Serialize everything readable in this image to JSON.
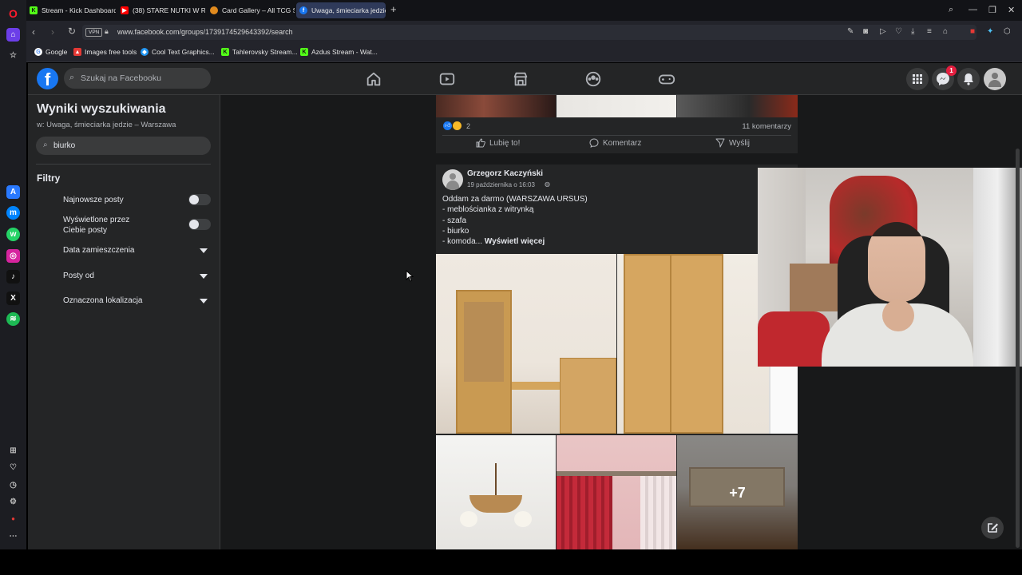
{
  "browser": {
    "tabs": [
      {
        "label": "Stream - Kick Dashboard",
        "active": false,
        "fav_color": "#53fc18",
        "fav_glyph": "K"
      },
      {
        "label": "(38) STARE NUTKI W RE",
        "active": false,
        "fav_color": "#ff0000",
        "fav_glyph": "▶"
      },
      {
        "label": "Card Gallery – All TCG Set",
        "active": false,
        "fav_color": "#e08a1e",
        "fav_glyph": "●"
      },
      {
        "label": "Uwaga, śmieciarka jedzie",
        "active": true,
        "fav_color": "#1877f2",
        "fav_glyph": "f"
      }
    ],
    "vpn_label": "VPN",
    "url": "www.facebook.com/groups/1739174529643392/search",
    "bookmarks": [
      {
        "label": "Google",
        "fav_color": "#4285f4",
        "fav_glyph": "G"
      },
      {
        "label": "Images free tools",
        "fav_color": "#e53935",
        "fav_glyph": "▲"
      },
      {
        "label": "Cool Text Graphics...",
        "fav_color": "#2196f3",
        "fav_glyph": "◆"
      },
      {
        "label": "Tahlerovsky Stream...",
        "fav_color": "#53fc18",
        "fav_glyph": "K"
      },
      {
        "label": "Azdus Stream - Wat...",
        "fav_color": "#53fc18",
        "fav_glyph": "K"
      }
    ]
  },
  "facebook": {
    "search_placeholder": "Szukaj na Facebooku",
    "notification_count": "1",
    "left_panel": {
      "title": "Wyniki wyszukiwania",
      "subtitle": "w: Uwaga, śmieciarka jedzie – Warszawa",
      "search_value": "biurko",
      "filters_heading": "Filtry",
      "toggles": [
        {
          "label": "Najnowsze posty",
          "on": false
        },
        {
          "label": "Wyświetlone przez Ciebie posty",
          "on": false
        }
      ],
      "dropdowns": [
        "Data zamieszczenia",
        "Posty od",
        "Oznaczona lokalizacja"
      ]
    },
    "prev_post": {
      "reaction_count": "2",
      "comments_count": "11 komentarzy",
      "like_label": "Lubię to!",
      "comment_label": "Komentarz",
      "share_label": "Wyślij"
    },
    "post": {
      "author": "Grzegorz Kaczyński",
      "date": "19 października o 16:03",
      "lines": [
        "Oddam za darmo (WARSZAWA URSUS)",
        "- meblościanka z witrynką",
        "- szafa",
        "- biurko"
      ],
      "last_line": "- komoda...",
      "see_more": "Wyświetl więcej",
      "more_photos": "+7"
    }
  }
}
